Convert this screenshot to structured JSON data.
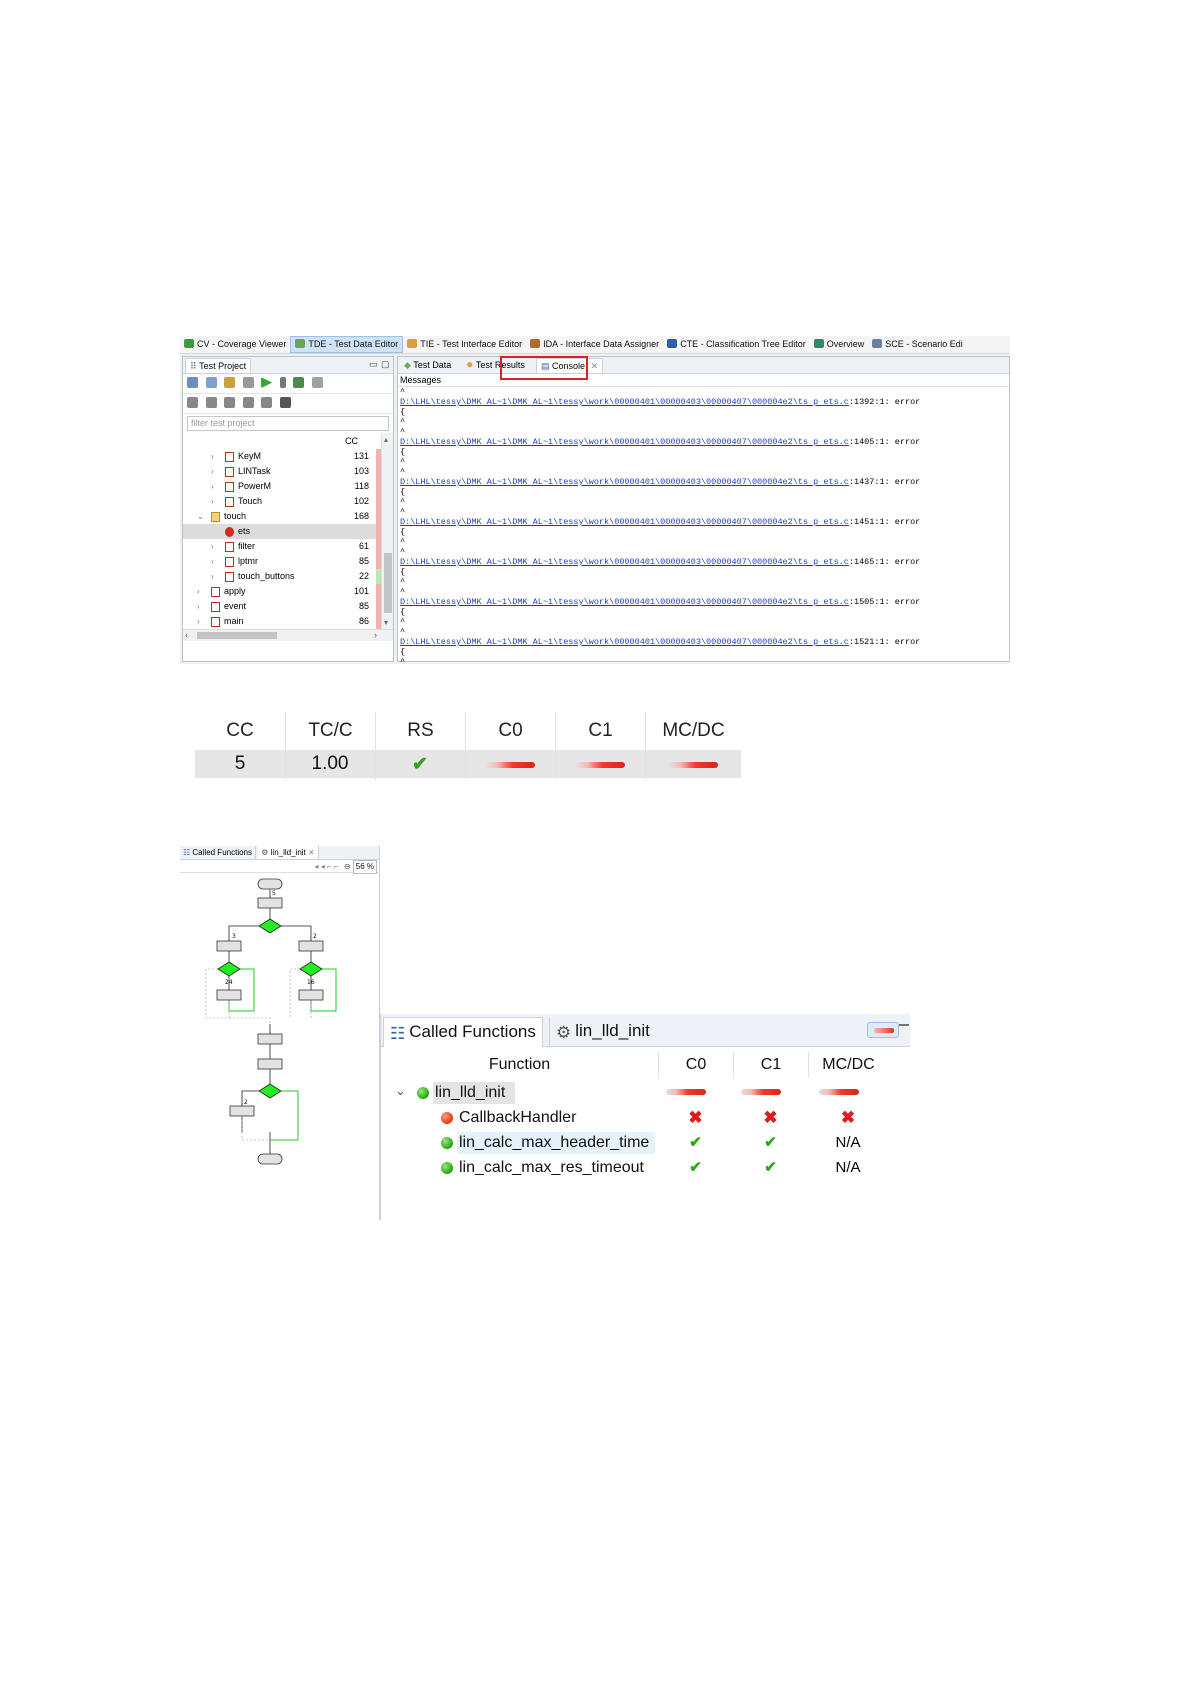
{
  "perspectives": [
    {
      "label": "CV - Coverage Viewer",
      "color": "#3a9b3a"
    },
    {
      "label": "TDE - Test Data Editor",
      "color": "#6aa84f",
      "active": true
    },
    {
      "label": "TIE - Test Interface Editor",
      "color": "#d9a23c"
    },
    {
      "label": "IDA - Interface Data Assigner",
      "color": "#b36b2b"
    },
    {
      "label": "CTE - Classification Tree Editor",
      "color": "#2e5fa8"
    },
    {
      "label": "Overview",
      "color": "#2a8a6e"
    },
    {
      "label": "SCE - Scenario Edi",
      "color": "#6b7f9e"
    }
  ],
  "test_project": {
    "tab_label": "Test Project",
    "filter_placeholder": "filter test project",
    "cc_header": "CC",
    "rows": [
      {
        "label": "KeyM",
        "cc": "131",
        "indent": 3
      },
      {
        "label": "LINTask",
        "cc": "103",
        "indent": 3
      },
      {
        "label": "PowerM",
        "cc": "118",
        "indent": 3
      },
      {
        "label": "Touch",
        "cc": "102",
        "indent": 3
      },
      {
        "label": "touch",
        "cc": "168",
        "indent": 2,
        "expanded": true
      },
      {
        "label": "ets",
        "cc": "",
        "indent": 3,
        "selected": true
      },
      {
        "label": "filter",
        "cc": "61",
        "indent": 3
      },
      {
        "label": "lptmr",
        "cc": "85",
        "indent": 3
      },
      {
        "label": "touch_buttons",
        "cc": "22",
        "indent": 3
      },
      {
        "label": "apply",
        "cc": "101",
        "indent": 2
      },
      {
        "label": "event",
        "cc": "85",
        "indent": 2
      },
      {
        "label": "main",
        "cc": "86",
        "indent": 2
      }
    ]
  },
  "editor_tabs": {
    "test_data": "Test Data",
    "test_results": "Test Results",
    "console": "Console"
  },
  "console": {
    "header": "Messages",
    "lines": [
      {
        "path": "D:\\LHL\\tessy\\DMK AL~1\\DMK AL~1\\tessy\\work\\00000401\\00000403\\00000407\\000004e2\\ts p ets.c",
        "rest": ":1392:1: error"
      },
      {
        "path": "D:\\LHL\\tessy\\DMK AL~1\\DMK AL~1\\tessy\\work\\00000401\\00000403\\00000407\\000004e2\\ts p ets.c",
        "rest": ":1405:1: error"
      },
      {
        "path": "D:\\LHL\\tessy\\DMK AL~1\\DMK AL~1\\tessy\\work\\00000401\\00000403\\00000407\\000004e2\\ts p ets.c",
        "rest": ":1437:1: error"
      },
      {
        "path": "D:\\LHL\\tessy\\DMK AL~1\\DMK AL~1\\tessy\\work\\00000401\\00000403\\00000407\\000004e2\\ts p ets.c",
        "rest": ":1451:1: error"
      },
      {
        "path": "D:\\LHL\\tessy\\DMK AL~1\\DMK AL~1\\tessy\\work\\00000401\\00000403\\00000407\\000004e2\\ts p ets.c",
        "rest": ":1465:1: error"
      },
      {
        "path": "D:\\LHL\\tessy\\DMK AL~1\\DMK AL~1\\tessy\\work\\00000401\\00000403\\00000407\\000004e2\\ts p ets.c",
        "rest": ":1505:1: error"
      },
      {
        "path": "D:\\LHL\\tessy\\DMK AL~1\\DMK AL~1\\tessy\\work\\00000401\\00000403\\00000407\\000004e2\\ts p ets.c",
        "rest": ":1521:1: error"
      }
    ]
  },
  "summary": {
    "headers": {
      "cc": "CC",
      "tcc": "TC/C",
      "rs": "RS",
      "c0": "C0",
      "c1": "C1",
      "mcdc": "MC/DC"
    },
    "values": {
      "cc": "5",
      "tcc": "1.00",
      "rs": "✔"
    },
    "coverage_level": {
      "c0": 0.0,
      "c1": 0.0,
      "mcdc": 0.0
    }
  },
  "flow_graph": {
    "tabs": {
      "called_functions": "Called Functions",
      "function": "lin_lld_init"
    },
    "zoom": "56 %",
    "edge_labels": {
      "top": "5",
      "left": "3",
      "right": "2",
      "left_loop": "24",
      "right_loop": "16",
      "bottom": "2"
    }
  },
  "called_functions": {
    "tab_label": "Called Functions",
    "function_tab_label": "lin_lld_init",
    "columns": {
      "function": "Function",
      "c0": "C0",
      "c1": "C1",
      "mcdc": "MC/DC"
    },
    "root": {
      "name": "lin_lld_init",
      "status": "green"
    },
    "children": [
      {
        "name": "CallbackHandler",
        "status": "red",
        "c0": "✖",
        "c1": "✖",
        "mcdc": "✖"
      },
      {
        "name": "lin_calc_max_header_time",
        "status": "green",
        "c0": "✔",
        "c1": "✔",
        "mcdc": "N/A"
      },
      {
        "name": "lin_calc_max_res_timeout",
        "status": "green",
        "c0": "✔",
        "c1": "✔",
        "mcdc": "N/A"
      }
    ]
  },
  "colors": {
    "accent_red": "#e21a1a",
    "check_green": "#2ea61c",
    "console_link": "#1a3fb8",
    "flow_green": "#22dd22"
  }
}
